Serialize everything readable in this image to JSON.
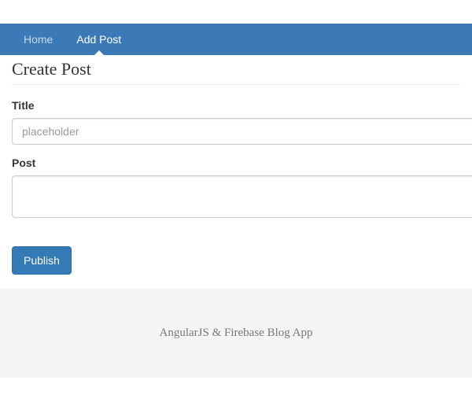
{
  "nav": {
    "items": [
      {
        "label": "Home",
        "active": false
      },
      {
        "label": "Add Post",
        "active": true
      }
    ]
  },
  "header": {
    "title": "Create Post"
  },
  "form": {
    "title": {
      "label": "Title",
      "placeholder": "placeholder",
      "value": ""
    },
    "post": {
      "label": "Post",
      "value": ""
    },
    "submit_label": "Publish"
  },
  "footer": {
    "text": "AngularJS & Firebase Blog App"
  }
}
